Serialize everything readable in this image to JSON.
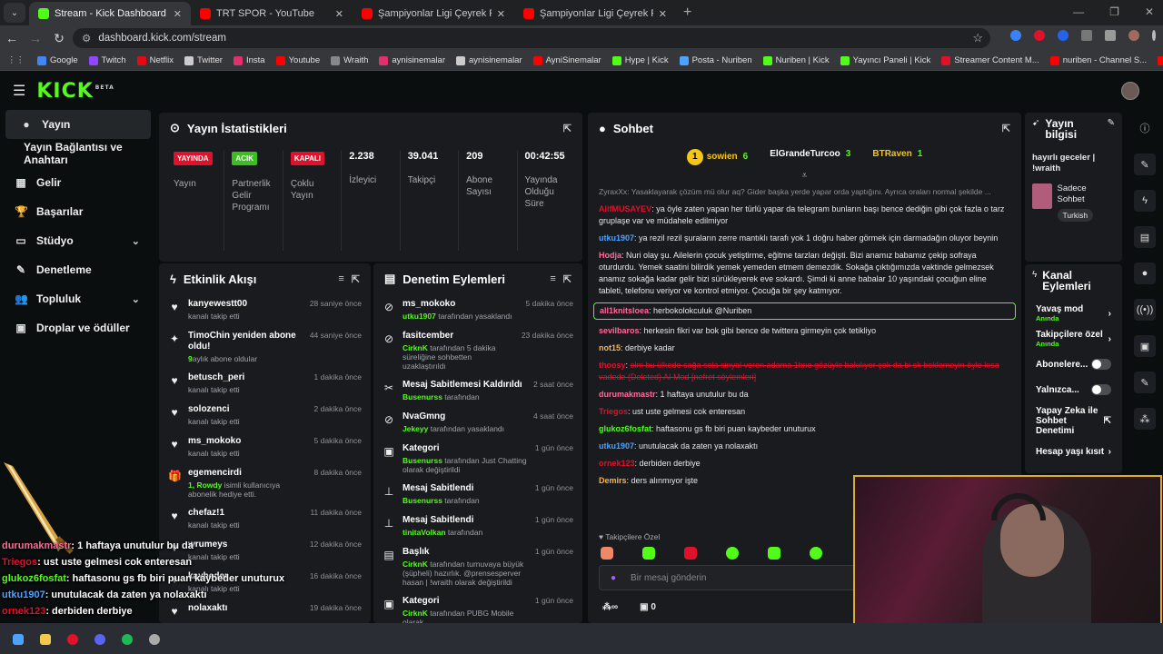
{
  "browser": {
    "tabs": [
      {
        "title": "Stream - Kick Dashboard",
        "color": "#53fc18",
        "active": true
      },
      {
        "title": "TRT SPOR - YouTube",
        "color": "#ff0000",
        "active": false
      },
      {
        "title": "Şampiyonlar Ligi Çeyrek Final |",
        "color": "#ff0000",
        "active": false
      },
      {
        "title": "Şampiyonlar Ligi Çeyrek Final |",
        "color": "#ff0000",
        "active": false
      }
    ],
    "url": "dashboard.kick.com/stream",
    "bookmarks": [
      "Google",
      "Twitch",
      "Netflix",
      "Twitter",
      "Insta",
      "Youtube",
      "Wraith",
      "aynisinemalar",
      "aynisinemalar",
      "AyniSinemalar",
      "Hype | Kick",
      "Posta - Nuriben",
      "Nuriben | Kick",
      "Yayıncı Paneli | Kick",
      "Streamer Content M...",
      "nuriben - Channel S...",
      "Aynı Sinemalar - Ça..."
    ]
  },
  "header": {
    "logo": "KICK",
    "beta": "BETA"
  },
  "sidebar": {
    "items": [
      {
        "label": "Yayın",
        "icon": "●",
        "active": true
      },
      {
        "label": "Yayın Bağlantısı ve Anahtarı",
        "icon": ""
      },
      {
        "label": "Gelir",
        "icon": "▦"
      },
      {
        "label": "Başarılar",
        "icon": "🏆"
      },
      {
        "label": "Stüdyo",
        "icon": "▭",
        "chev": true
      },
      {
        "label": "Denetleme",
        "icon": "✎"
      },
      {
        "label": "Topluluk",
        "icon": "👥",
        "chev": true
      },
      {
        "label": "Droplar ve ödüller",
        "icon": "▣"
      }
    ]
  },
  "stats": {
    "title": "Yayın İstatistikleri",
    "items": [
      {
        "badge": "YAYINDA",
        "badge_color": "#e0112b",
        "label": "Yayın"
      },
      {
        "badge": "ACIK",
        "badge_color": "#3bbf1e",
        "label": "Partnerlik Gelir Programı"
      },
      {
        "badge": "KAPALI",
        "badge_color": "#e0112b",
        "label": "Çoklu Yayın"
      },
      {
        "value": "2.238",
        "label": "İzleyici"
      },
      {
        "value": "39.041",
        "label": "Takipçi"
      },
      {
        "value": "209",
        "label": "Abone Sayısı"
      },
      {
        "value": "00:42:55",
        "label": "Yayında Olduğu Süre"
      }
    ]
  },
  "activity": {
    "title": "Etkinlik Akışı",
    "items": [
      {
        "name": "kanyewestt00",
        "sub": "kanalı takip etti",
        "time": "28 saniye önce",
        "icon": "♥"
      },
      {
        "name": "TimoChin yeniden abone oldu!",
        "sub": "aylık abone oldular",
        "sub_hl": "9",
        "time": "44 saniye önce",
        "icon": "✦"
      },
      {
        "name": "betusch_peri",
        "sub": "kanalı takip etti",
        "time": "1 dakika önce",
        "icon": "♥"
      },
      {
        "name": "solozenci",
        "sub": "kanalı takip etti",
        "time": "2 dakika önce",
        "icon": "♥"
      },
      {
        "name": "ms_mokoko",
        "sub": "kanalı takip etti",
        "time": "5 dakika önce",
        "icon": "♥"
      },
      {
        "name": "egemencirdi",
        "sub": " isimli kullanıcıya abonelik hediye etti.",
        "sub_hl": "1, Rowdy",
        "time": "8 dakika önce",
        "icon": "🎁"
      },
      {
        "name": "chefaz!1",
        "sub": "kanalı takip etti",
        "time": "11 dakika önce",
        "icon": "♥"
      },
      {
        "name": "wrumeys",
        "sub": "kanalı takip etti",
        "time": "12 dakika önce",
        "icon": "♥"
      },
      {
        "name": "kaybeder",
        "sub": "kanalı takip etti",
        "time": "16 dakika önce",
        "icon": "♥"
      },
      {
        "name": "nolaxaktı",
        "sub": "",
        "time": "19 dakika önce",
        "icon": "♥"
      }
    ]
  },
  "moderation": {
    "title": "Denetim Eylemleri",
    "items": [
      {
        "name": "ms_mokoko",
        "sub_hl": "utku1907",
        "sub": " tarafından yasaklandı",
        "time": "5 dakika önce",
        "icon": "⊘"
      },
      {
        "name": "fasitcember",
        "sub_hl": "CirknK",
        "sub": " tarafından 5 dakika süreliğine sohbetten uzaklaştırıldı",
        "time": "23 dakika önce",
        "icon": "⊘"
      },
      {
        "name": "Mesaj Sabitlemesi Kaldırıldı",
        "sub_hl": "Busenurss",
        "sub": " tarafından",
        "time": "2 saat önce",
        "icon": "✂"
      },
      {
        "name": "NvaGmng",
        "sub_hl": "Jekeyy",
        "sub": " tarafından yasaklandı",
        "time": "4 saat önce",
        "icon": "⊘"
      },
      {
        "name": "Kategori",
        "sub_hl": "Busenurss",
        "sub": " tarafından Just Chatting olarak değiştirildi",
        "time": "1 gün önce",
        "icon": "▣"
      },
      {
        "name": "Mesaj Sabitlendi",
        "sub_hl": "Busenurss",
        "sub": " tarafından",
        "time": "1 gün önce",
        "icon": "⊥"
      },
      {
        "name": "Mesaj Sabitlendi",
        "sub_hl": "tinitaVolkan",
        "sub": " tarafından",
        "time": "1 gün önce",
        "icon": "⊥"
      },
      {
        "name": "Başlık",
        "sub_hl": "CirknK",
        "sub": " tarafından turnuvaya büyük (şüpheli) hazırlık. @prensesperver hasan | !wraith olarak değiştirildi",
        "time": "1 gün önce",
        "icon": "▤"
      },
      {
        "name": "Kategori",
        "sub_hl": "CirknK",
        "sub": " tarafından PUBG Mobile olarak",
        "time": "1 gün önce",
        "icon": "▣"
      }
    ]
  },
  "chat": {
    "title": "Sohbet",
    "top": [
      {
        "rank": "1",
        "name": "sowien",
        "count": "6",
        "color": "#f5c518"
      },
      {
        "name": "ElGrandeTurcoo",
        "count": "3",
        "color": "#ffffff"
      },
      {
        "name": "BTRaven",
        "count": "1",
        "color": "#f5c518"
      }
    ],
    "reply": "ZyraxXx: Yasaklayarak çözüm mü olur aq? Gider başka yerde yapar orda yaptığını. Ayrıca oraları normal şekilde ...",
    "messages": [
      {
        "user": "AlifMUSAYEV",
        "color": "#e0112b",
        "text": "ya öyle zaten yapan her türlü yapar da telegram bunların başı bence dediğin gibi çok fazla o tarz gruplaşe var ve müdahele edilmiyor"
      },
      {
        "user": "utku1907",
        "color": "#4fa3ff",
        "text": "ya rezil rezil şuraların zerre mantıklı tarafı yok 1 doğru haber görmek için darmadağın oluyor beynin"
      },
      {
        "user": "Hodja",
        "color": "#ff6b9a",
        "text": "Nuri olay şu. Ailelerin çocuk yetiştirme, eğitme tarzları değişti. Bizi anamız babamız çekip sofraya oturdurdu. Yemek saatini bilirdik yemek yemeden etmem demezdik. Sokağa çıktığımızda vaktinde gelmezsek anamız sokağa kadar gelir bizi sürükleyerek eve sokardı. Şimdi ki anne babalar 10 yaşındaki çocuğun eline tableti, telefonu veriyor ve kontrol etmiyor. Çocuğa bir şey katmıyor."
      },
      {
        "user": "all1knitsloea",
        "color": "#ff6b9a",
        "text": "herbokolokculuk @Nuriben",
        "highlight": true
      },
      {
        "user": "sevilbaros",
        "color": "#ff6b9a",
        "text": "herkesin fikri var bok gibi bence de twittera girmeyin çok tetikliyo"
      },
      {
        "user": "not15",
        "color": "#ffb347",
        "text": "derbiye kadar"
      },
      {
        "user": "thoosy",
        "color": "#e0112b",
        "text": "olm bu ülkede sağa sola sinyal veren adama 1bne gözüyle bakılıyor çok da bi sk beklemeyin öyle kısa vadede (Deleted) AI Mod [nefret söylemleri]",
        "deleted": true
      },
      {
        "user": "durumakmastr",
        "color": "#ff6b9a",
        "text": "1 haftaya unutulur bu da"
      },
      {
        "user": "Triegos",
        "color": "#e0112b",
        "text": "ust uste gelmesi cok enteresan"
      },
      {
        "user": "glukoz6fosfat",
        "color": "#53fc18",
        "text": "haftasonu gs fb biri puan kaybeder unuturux"
      },
      {
        "user": "utku1907",
        "color": "#4fa3ff",
        "text": "unutulacak da zaten ya nolaxaktı"
      },
      {
        "user": "ornek123",
        "color": "#e0112b",
        "text": "derbiden derbiye"
      },
      {
        "user": "Demirs",
        "color": "#ffb347",
        "text": "ders alınmıyor işte"
      }
    ],
    "followers_only": "Takipçilere Özel",
    "placeholder": "Bir mesaj gönderin",
    "count": "0"
  },
  "stream_info": {
    "title": "Yayın bilgisi",
    "stream_title": "hayırlı geceler | !wraith",
    "category": "Sadece Sohbet",
    "language": "Turkish"
  },
  "channel_actions": {
    "title": "Kanal Eylemleri",
    "items": [
      {
        "label": "Yavaş mod",
        "sub": "Anında",
        "type": "chev"
      },
      {
        "label": "Takipçilere özel",
        "sub": "Anında",
        "type": "chev"
      },
      {
        "label": "Abonelere...",
        "type": "toggle"
      },
      {
        "label": "Yalnızca...",
        "type": "toggle"
      },
      {
        "label": "Yapay Zeka ile Sohbet Denetimi",
        "type": "ext"
      },
      {
        "label": "Hesap yaşı kısıt",
        "type": "chev"
      }
    ]
  },
  "overlay": [
    {
      "user": "durumakmastr",
      "color": "#ff6b9a",
      "text": ": 1 haftaya unutulur bu da"
    },
    {
      "user": "Triegos",
      "color": "#e0112b",
      "text": ": ust uste gelmesi cok enteresan"
    },
    {
      "user": "glukoz6fosfat",
      "color": "#53fc18",
      "text": ": haftasonu gs fb biri puan kaybeder unuturux"
    },
    {
      "user": "utku1907",
      "color": "#4fa3ff",
      "text": ": unutulacak da zaten ya nolaxaktı"
    },
    {
      "user": "ornek123",
      "color": "#e0112b",
      "text": ": derbiden derbiye"
    },
    {
      "user": "Demirs",
      "color": "#ffb347",
      "text": ": ders alınmıyor işte"
    }
  ]
}
